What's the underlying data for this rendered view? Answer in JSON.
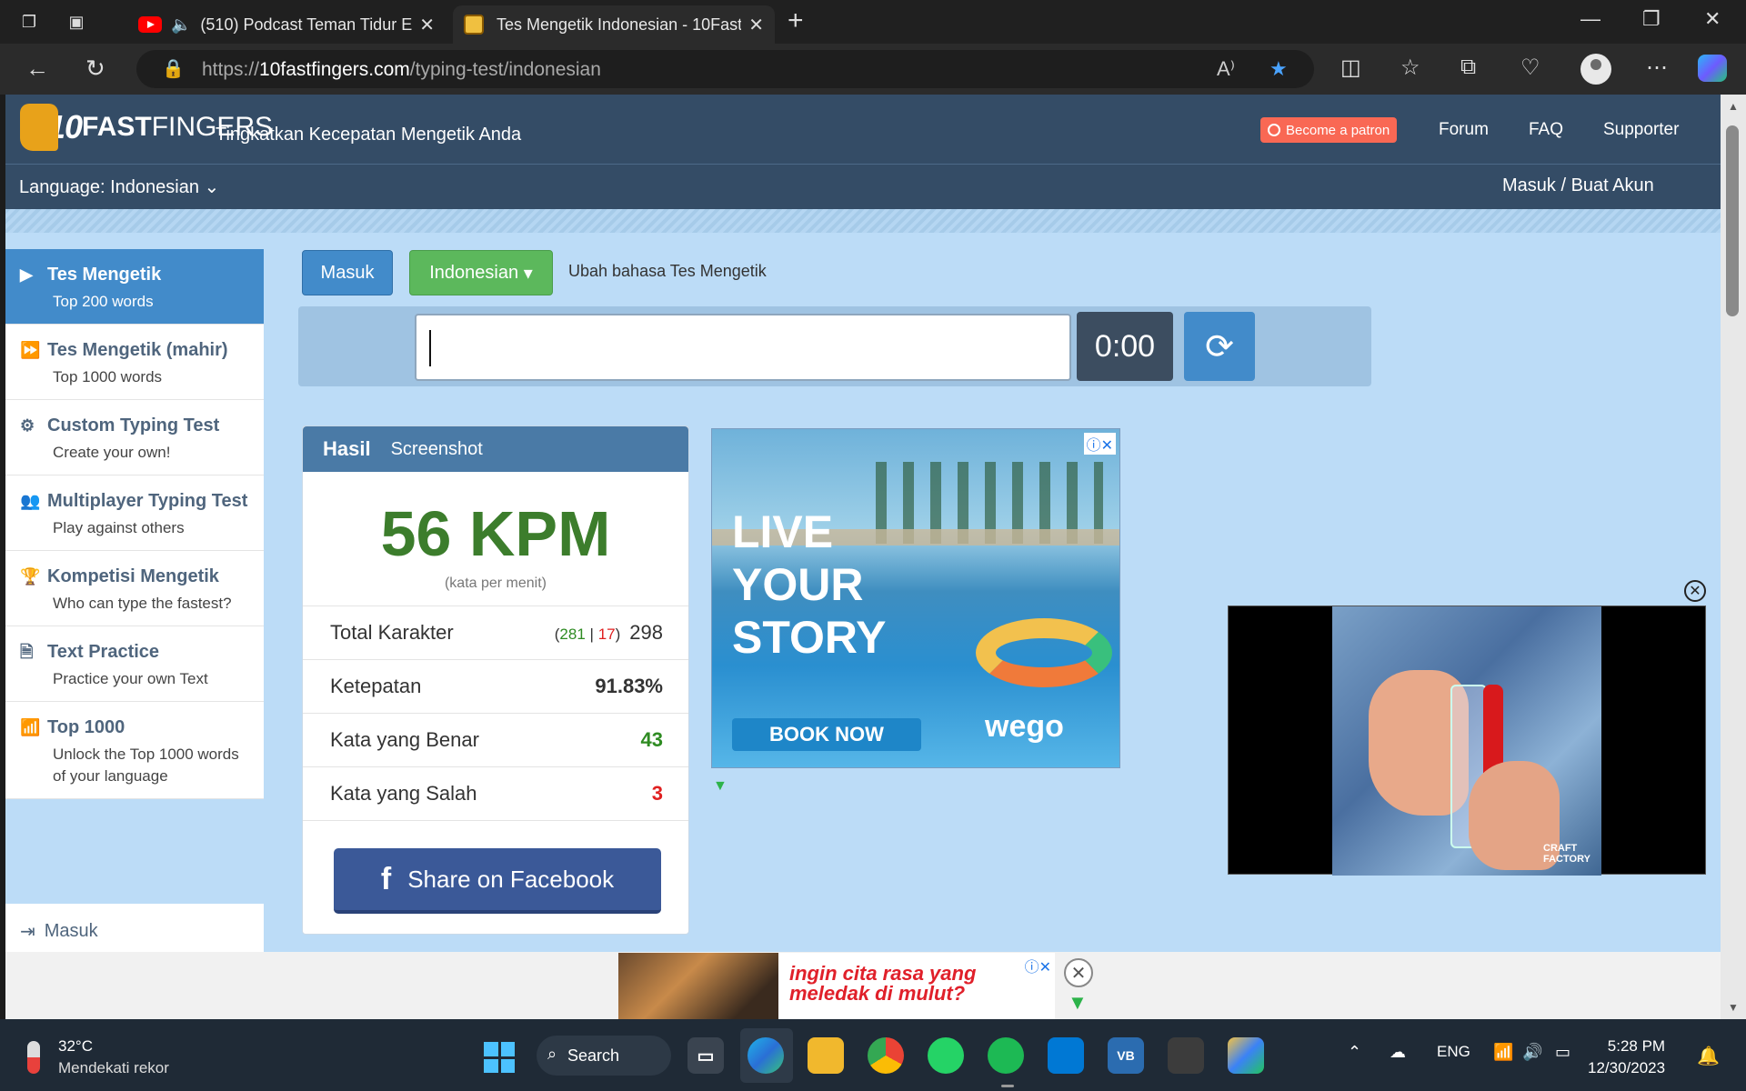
{
  "browser": {
    "tabs": [
      {
        "title": "(510) Podcast Teman Tidur E",
        "audio": true
      },
      {
        "title": "Tes Mengetik Indonesian - 10Fast",
        "active": true
      }
    ],
    "url_prefix": "https://",
    "url_host": "10fastfingers.com",
    "url_path": "/typing-test/indonesian"
  },
  "site": {
    "logo_ten": "10",
    "logo_fast": "FAST",
    "logo_fingers": "FINGERS",
    "tagline": "Tingkatkan Kecepatan Mengetik Anda",
    "patron_label": "Become a patron",
    "nav": [
      "Forum",
      "FAQ",
      "Supporter"
    ],
    "language_label": "Language: Indonesian",
    "login_label": "Masuk / Buat Akun"
  },
  "sidebar": {
    "items": [
      {
        "title": "Tes Mengetik",
        "sub": "Top 200 words"
      },
      {
        "title": "Tes Mengetik (mahir)",
        "sub": "Top 1000 words"
      },
      {
        "title": "Custom Typing Test",
        "sub": "Create your own!"
      },
      {
        "title": "Multiplayer Typing Test",
        "sub": "Play against others"
      },
      {
        "title": "Kompetisi Mengetik",
        "sub": "Who can type the fastest?"
      },
      {
        "title": "Text Practice",
        "sub": "Practice your own Text"
      },
      {
        "title": "Top 1000",
        "sub": "Unlock the Top 1000 words of your language"
      }
    ],
    "login": "Masuk"
  },
  "controls": {
    "masuk_button": "Masuk",
    "language_button": "Indonesian",
    "change_language_text": "Ubah bahasa Tes Mengetik",
    "timer": "0:00"
  },
  "results": {
    "tab_result": "Hasil",
    "tab_screenshot": "Screenshot",
    "wpm": "56 KPM",
    "wpm_caption": "(kata per menit)",
    "rows": [
      {
        "label": "Total Karakter",
        "correct": "281",
        "sep": "|",
        "wrong": "17",
        "value": "298"
      },
      {
        "label": "Ketepatan",
        "value": "91.83%"
      },
      {
        "label": "Kata yang Benar",
        "value": "43"
      },
      {
        "label": "Kata yang Salah",
        "value": "3"
      }
    ],
    "share_label": "Share on Facebook"
  },
  "ads": {
    "main_lines": [
      "LIVE",
      "YOUR",
      "STORY"
    ],
    "main_cta": "BOOK NOW",
    "main_brand": "wego",
    "video_brand": "CRAFT FACTORY",
    "bottom_text": "ingin cita rasa yang meledak di mulut?"
  },
  "taskbar": {
    "temperature": "32°C",
    "weather_desc": "Mendekati rekor",
    "search_label": "Search",
    "language": "ENG",
    "time": "5:28 PM",
    "date": "12/30/2023"
  },
  "colors": {
    "header": "#344c66",
    "active_side": "#428bca",
    "wpm_green": "#3c7d2c",
    "facebook": "#3b5998",
    "language_button": "#5cb85c"
  }
}
